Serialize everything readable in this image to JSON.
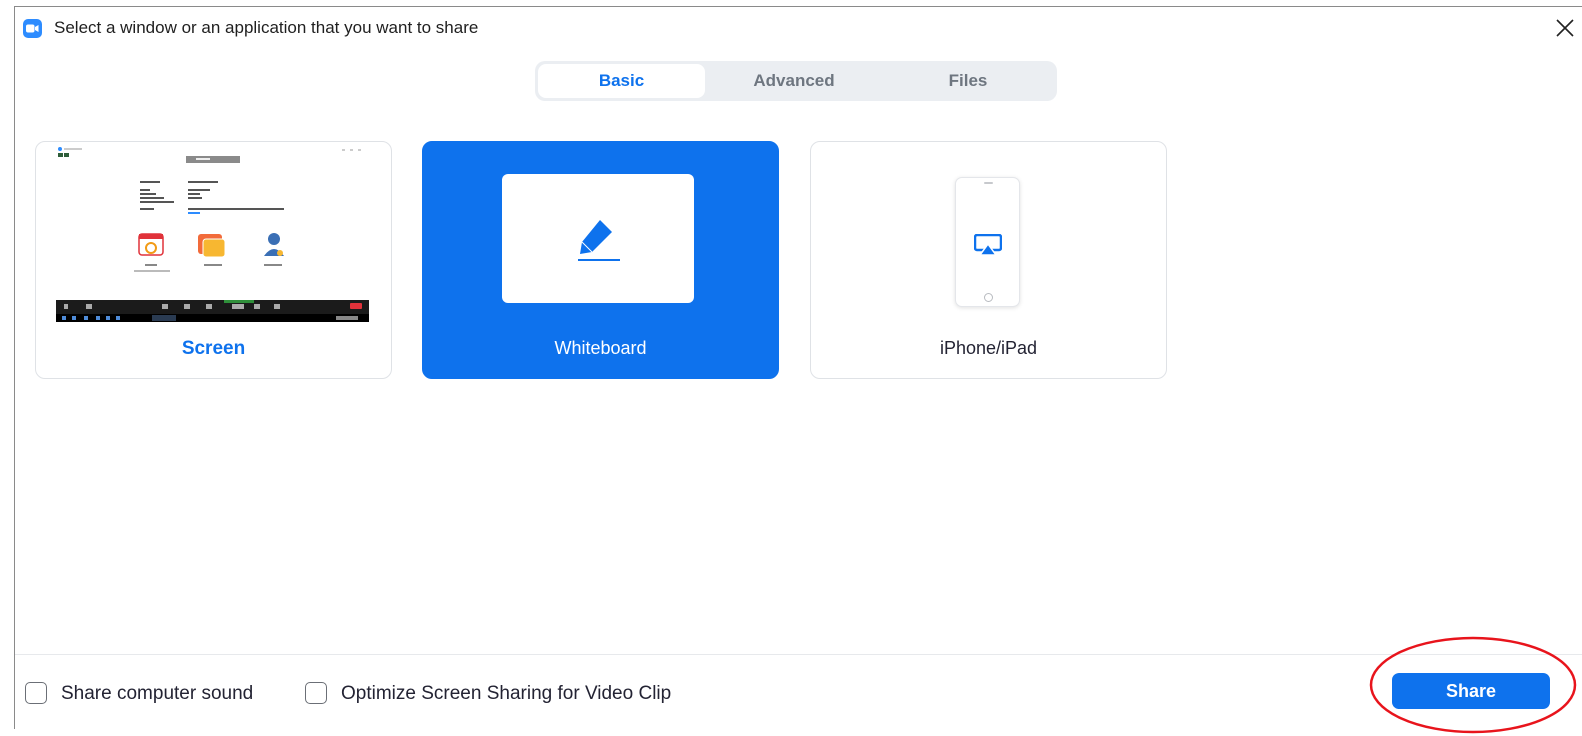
{
  "window": {
    "title": "Select a window or an application that you want to share",
    "close_icon": "close-icon",
    "app_icon": "zoom-camera-icon"
  },
  "tabs": [
    {
      "label": "Basic",
      "active": true
    },
    {
      "label": "Advanced",
      "active": false
    },
    {
      "label": "Files",
      "active": false
    }
  ],
  "share_options": [
    {
      "label": "Screen",
      "selected": false,
      "icon": "screen-thumbnail"
    },
    {
      "label": "Whiteboard",
      "selected": true,
      "icon": "pencil-icon"
    },
    {
      "label": "iPhone/iPad",
      "selected": false,
      "icon": "airplay-icon"
    }
  ],
  "footer": {
    "share_sound_label": "Share computer sound",
    "share_sound_checked": false,
    "optimize_video_label": "Optimize Screen Sharing for Video Clip",
    "optimize_video_checked": false,
    "share_button_label": "Share"
  },
  "colors": {
    "accent": "#0e72ed",
    "highlight_annotation": "#e8141c"
  }
}
